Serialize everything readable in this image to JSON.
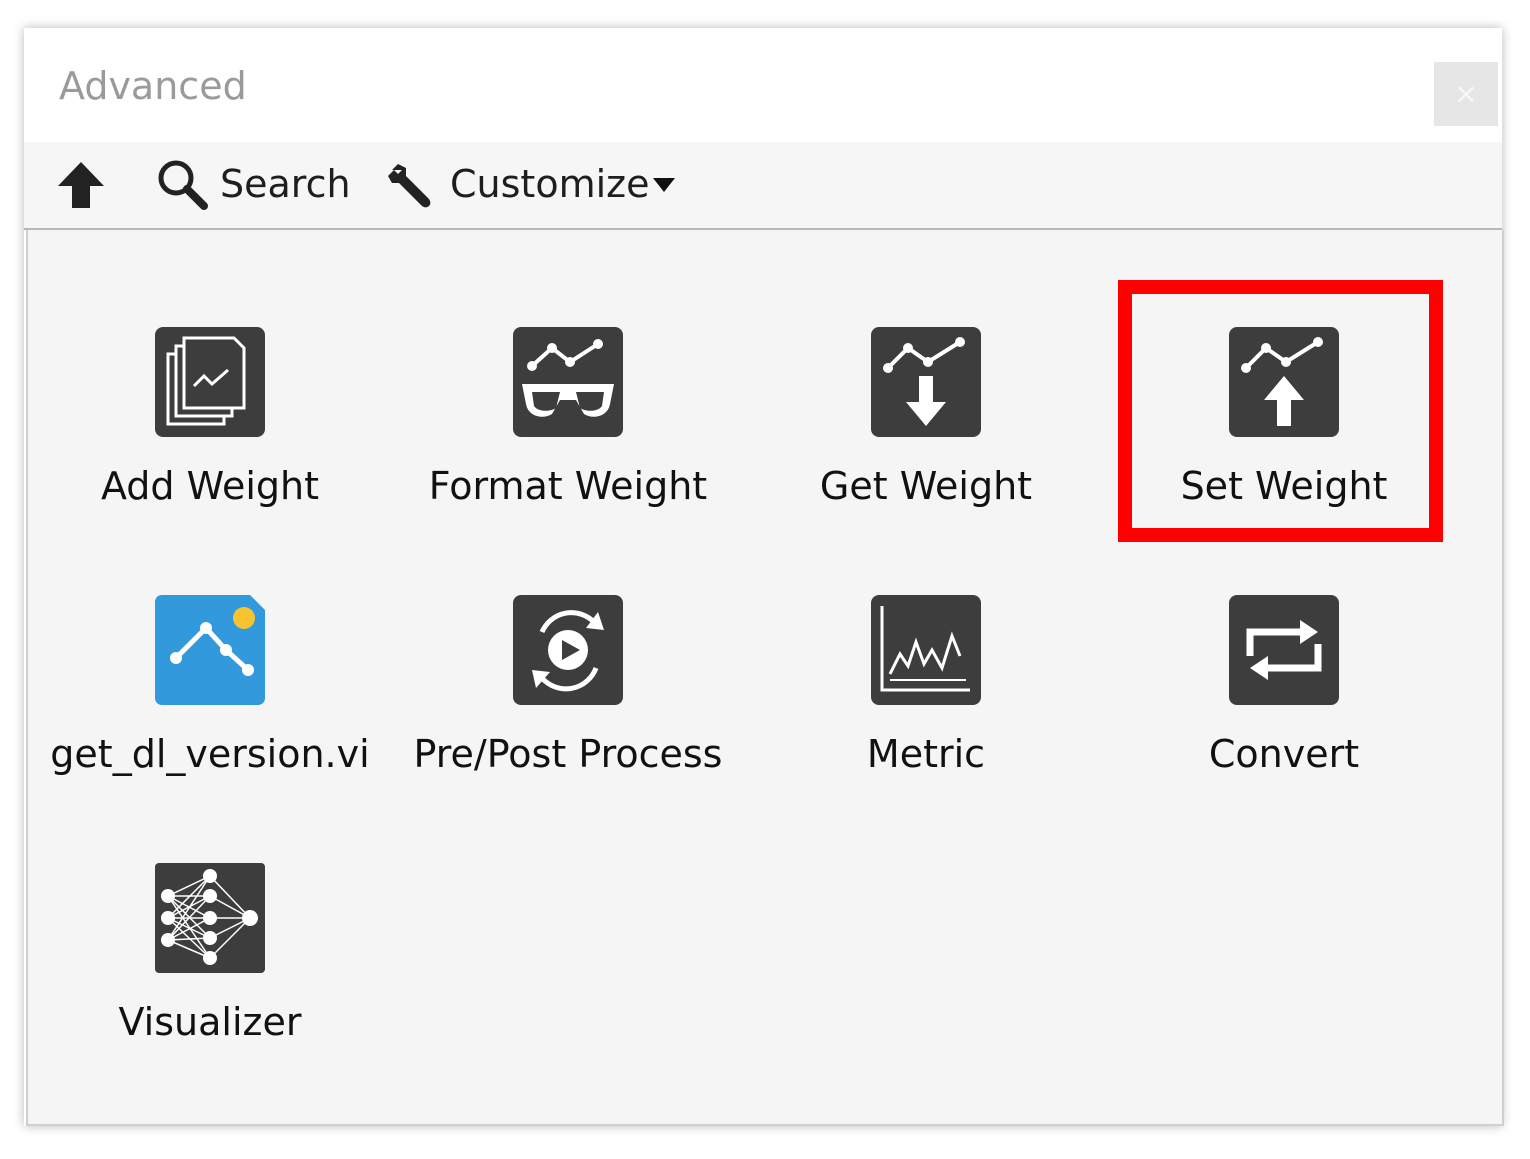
{
  "window": {
    "title": "Advanced",
    "close_label": "×"
  },
  "toolbar": {
    "search_label": "Search",
    "customize_label": "Customize"
  },
  "items": [
    {
      "label": "Add Weight",
      "icon": "add-weight-icon"
    },
    {
      "label": "Format Weight",
      "icon": "format-weight-icon"
    },
    {
      "label": "Get Weight",
      "icon": "get-weight-icon"
    },
    {
      "label": "Set Weight",
      "icon": "set-weight-icon"
    },
    {
      "label": "get_dl_version.vi",
      "icon": "vi-graph-icon"
    },
    {
      "label": "Pre/Post Process",
      "icon": "pre-post-process-icon"
    },
    {
      "label": "Metric",
      "icon": "metric-chart-icon"
    },
    {
      "label": "Convert",
      "icon": "convert-icon"
    },
    {
      "label": "Visualizer",
      "icon": "neural-network-icon"
    }
  ],
  "colors": {
    "icon_dark": "#3d3d3d",
    "icon_blue": "#3399dd",
    "highlight": "#ff0000"
  }
}
